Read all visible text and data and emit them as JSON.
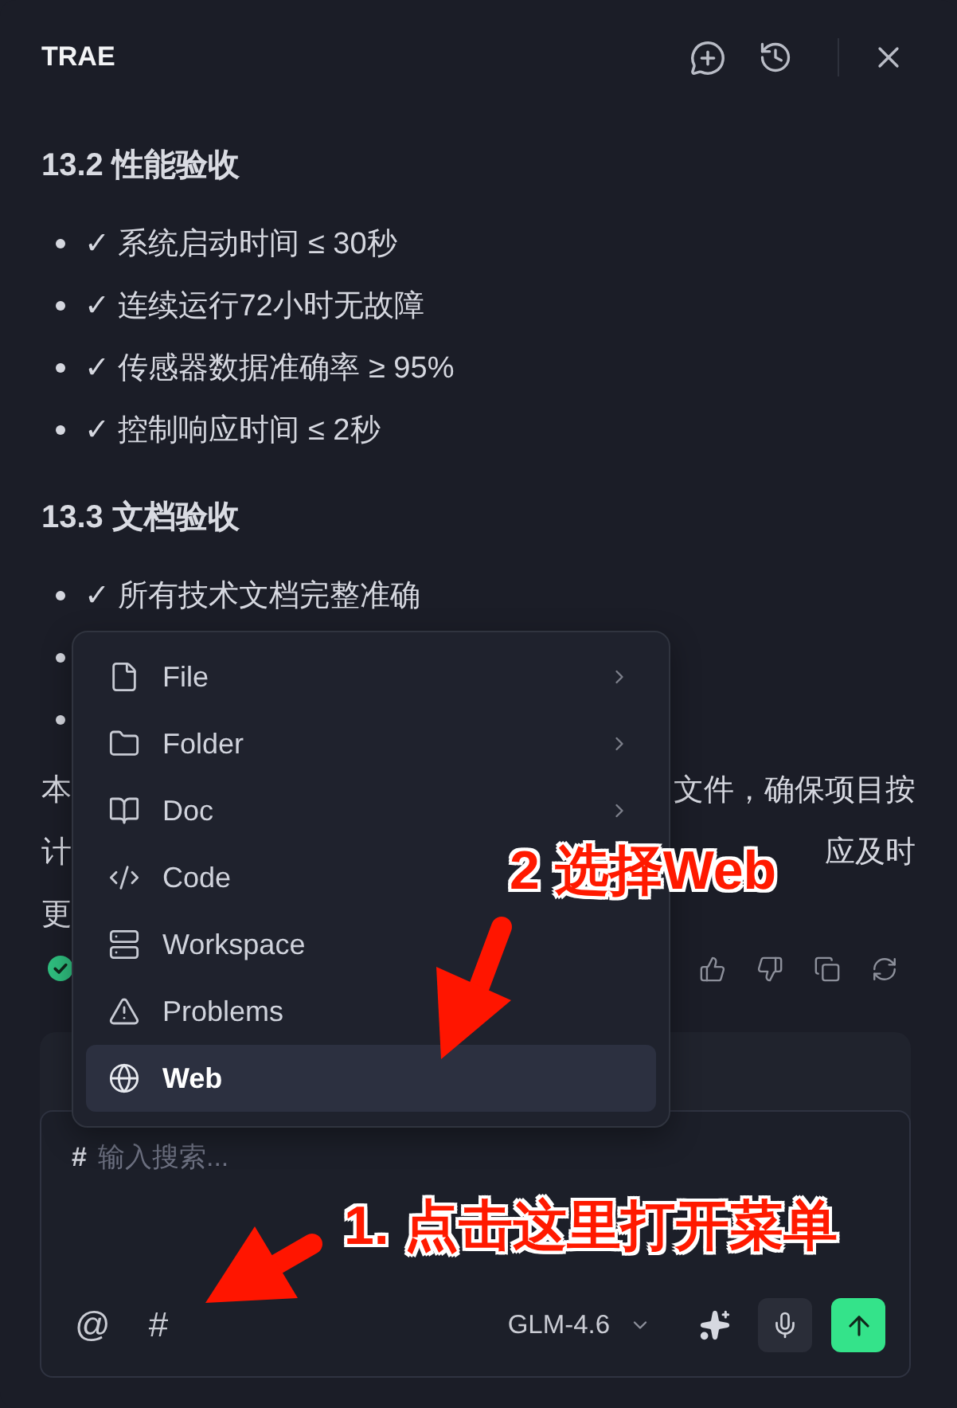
{
  "window": {
    "title": "TRAE"
  },
  "document": {
    "sections": [
      {
        "heading": "13.2 性能验收",
        "items": [
          {
            "kind": "text",
            "text": "✓ 系统启动时间 ≤ 30秒"
          },
          {
            "kind": "text",
            "text": "✓ 连续运行72小时无故障"
          },
          {
            "kind": "text",
            "text": "✓ 传感器数据准确率 ≥ 95%"
          },
          {
            "kind": "text",
            "text": "✓ 控制响应时间 ≤ 2秒"
          }
        ]
      },
      {
        "heading": "13.3 文档验收",
        "items": [
          {
            "kind": "text",
            "text": "✓ 所有技术文档完整准确"
          },
          {
            "kind": "marker"
          },
          {
            "kind": "marker"
          }
        ]
      }
    ],
    "paragraph_lines": [
      {
        "start": "本",
        "end": "文件，确保项目按"
      },
      {
        "start": "计",
        "end": "应及时"
      },
      {
        "start": "更"
      }
    ]
  },
  "menu": {
    "items": [
      {
        "kind": "file",
        "label": "File",
        "submenu": true,
        "selected": false
      },
      {
        "kind": "folder",
        "label": "Folder",
        "submenu": true,
        "selected": false
      },
      {
        "kind": "doc",
        "label": "Doc",
        "submenu": true,
        "selected": false
      },
      {
        "kind": "code",
        "label": "Code",
        "submenu": false,
        "selected": false
      },
      {
        "kind": "workspace",
        "label": "Workspace",
        "submenu": false,
        "selected": false
      },
      {
        "kind": "problems",
        "label": "Problems",
        "submenu": false,
        "selected": false
      },
      {
        "kind": "web",
        "label": "Web",
        "submenu": false,
        "selected": true
      }
    ]
  },
  "chat_input": {
    "prefix": "#",
    "placeholder": "输入搜索...",
    "tools": [
      "@",
      "#"
    ],
    "model": "GLM-4.6"
  },
  "annotations": [
    {
      "text": "2 选择Web"
    },
    {
      "text": "1. 点击这里打开菜单"
    }
  ]
}
